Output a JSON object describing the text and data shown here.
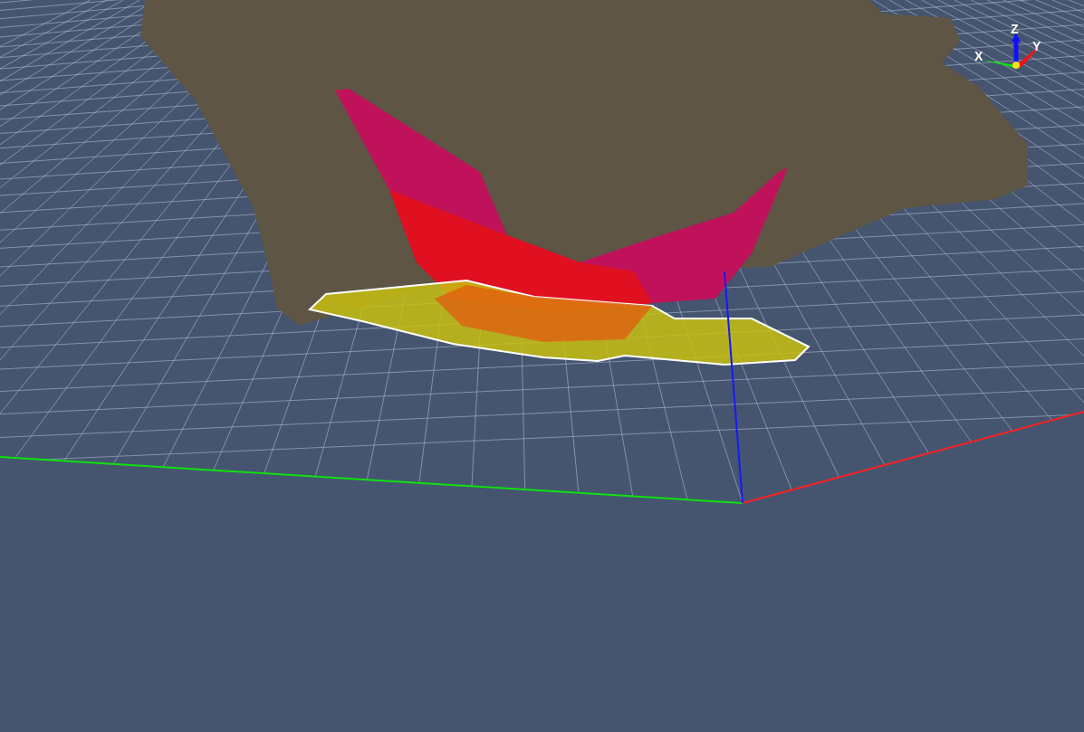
{
  "axis_gizmo": {
    "x_label": "X",
    "y_label": "Y",
    "z_label": "Z"
  }
}
